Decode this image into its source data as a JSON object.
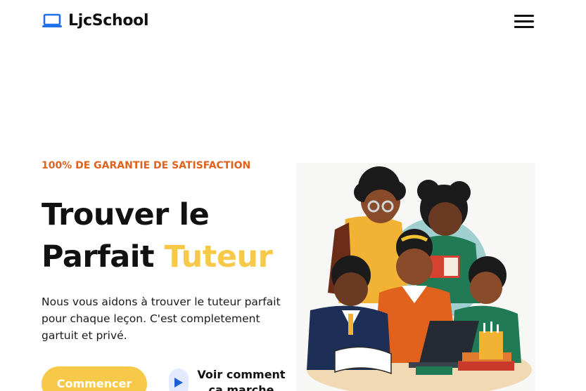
{
  "brand": {
    "name": "LjcSchool",
    "icon": "laptop-icon"
  },
  "nav": {
    "menu_icon": "hamburger-menu-icon"
  },
  "hero": {
    "eyebrow": "100% DE GARANTIE DE SATISFACTION",
    "headline_line1": "Trouver le",
    "headline_line2_prefix": "Parfait ",
    "headline_line2_accent": "Tuteur",
    "lead": "Nous vous aidons à trouver le tuteur parfait pour chaque leçon. C'est completement gartuit et privé.",
    "cta_label": "Commencer",
    "secondary_link_label": "Voir comment ça marche",
    "play_icon": "play-icon",
    "illustration_alt": ""
  },
  "colors": {
    "accent_yellow": "#f7c948",
    "eyebrow_orange": "#e0621c",
    "brand_blue": "#1e6fe8",
    "play_bg": "#e3eafd",
    "play_blue": "#1e5fd8",
    "text_dark": "#111111"
  }
}
